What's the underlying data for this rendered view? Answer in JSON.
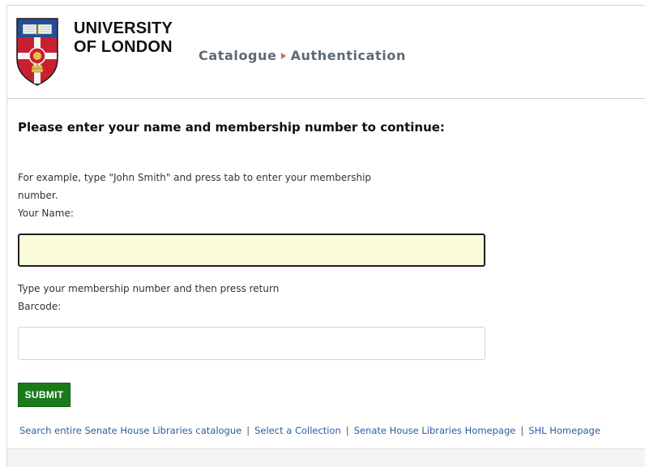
{
  "header": {
    "logo_line1": "UNIVERSITY",
    "logo_line2": "OF LONDON",
    "breadcrumb": [
      {
        "label": "Catalogue"
      },
      {
        "label": "Authentication"
      }
    ],
    "colors": {
      "crest_red": "#c8202f",
      "crest_blue": "#1f4e9c",
      "crest_gold": "#e8c34a",
      "breadcrumb_separator": "#e0645c"
    },
    "icons": {
      "crest": "university-crest-logo",
      "separator": "triangle-right-icon"
    }
  },
  "form": {
    "heading": "Please enter your name and membership number to continue:",
    "name_help_line1": "For example, type \"John Smith\" and press tab to enter your membership",
    "name_help_line2": "number.",
    "name_label": "Your Name:",
    "name_value": "",
    "barcode_help": "Type your membership number and then press return",
    "barcode_label": "Barcode:",
    "barcode_value": "",
    "submit_label": "SUBMIT",
    "colors": {
      "name_field_bg": "#fafcd9",
      "submit_bg": "#1a7a1a"
    }
  },
  "footer": {
    "links": [
      "Search entire Senate House Libraries catalogue",
      "Select a Collection",
      "Senate House Libraries Homepage",
      "SHL Homepage"
    ],
    "link_color": "#2b5c9e"
  }
}
